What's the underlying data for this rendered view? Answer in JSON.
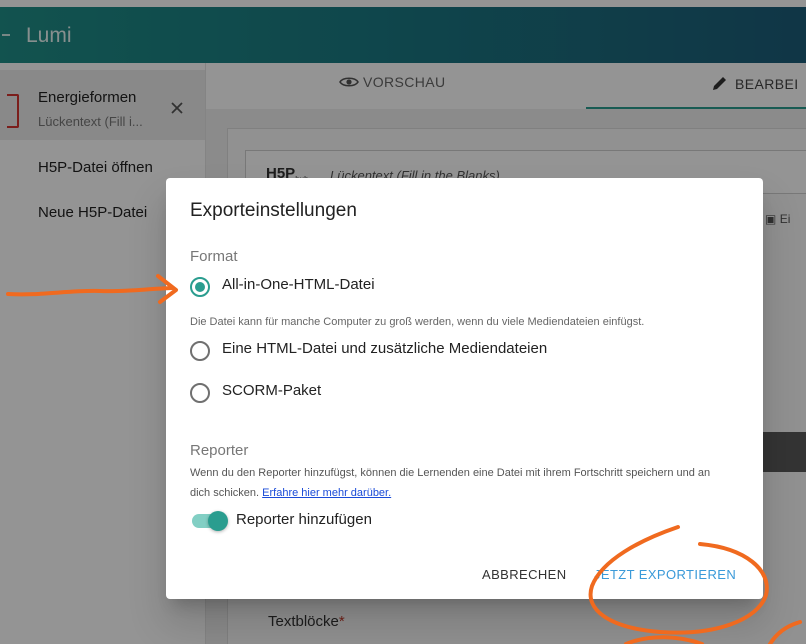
{
  "app": {
    "title": "Lumi"
  },
  "sidebar": {
    "open_document": {
      "title": "Energieformen",
      "subtitle": "Lückentext (Fill i..."
    },
    "items": [
      {
        "label": "H5P-Datei öffnen"
      },
      {
        "label": "Neue H5P-Datei"
      }
    ]
  },
  "tabs": [
    {
      "label": "VORSCHAU",
      "icon": "eye-icon"
    },
    {
      "label": "BEARBEI",
      "icon": "pencil-icon",
      "active": true
    }
  ],
  "editor": {
    "logo": "H5P",
    "logo_sub": "hub",
    "content_type": "Lückentext (Fill in the Blanks)",
    "side_button": "Ei",
    "field_label": "Textblöcke",
    "required_mark": "*"
  },
  "dialog": {
    "title": "Exporteinstellungen",
    "format_label": "Format",
    "options": [
      {
        "label": "All-in-One-HTML-Datei",
        "selected": true
      },
      {
        "label": "Eine HTML-Datei und zusätzliche Mediendateien",
        "selected": false
      },
      {
        "label": "SCORM-Paket",
        "selected": false
      }
    ],
    "hint": "Die Datei kann für manche Computer zu groß werden, wenn du viele Mediendateien einfügst.",
    "reporter": {
      "label": "Reporter",
      "description": "Wenn du den Reporter hinzufügst, können die Lernenden eine Datei mit ihrem Fortschritt speichern und an dich schicken.",
      "link": "Erfahre hier mehr darüber.",
      "toggle_label": "Reporter hinzufügen",
      "toggle_on": true
    },
    "buttons": {
      "cancel": "ABBRECHEN",
      "export": "JETZT EXPORTIEREN"
    }
  },
  "colors": {
    "accent": "#2a9d8f",
    "link": "#1a4bd8",
    "export_button": "#3a9ad9",
    "annotation": "#f06a1f"
  }
}
